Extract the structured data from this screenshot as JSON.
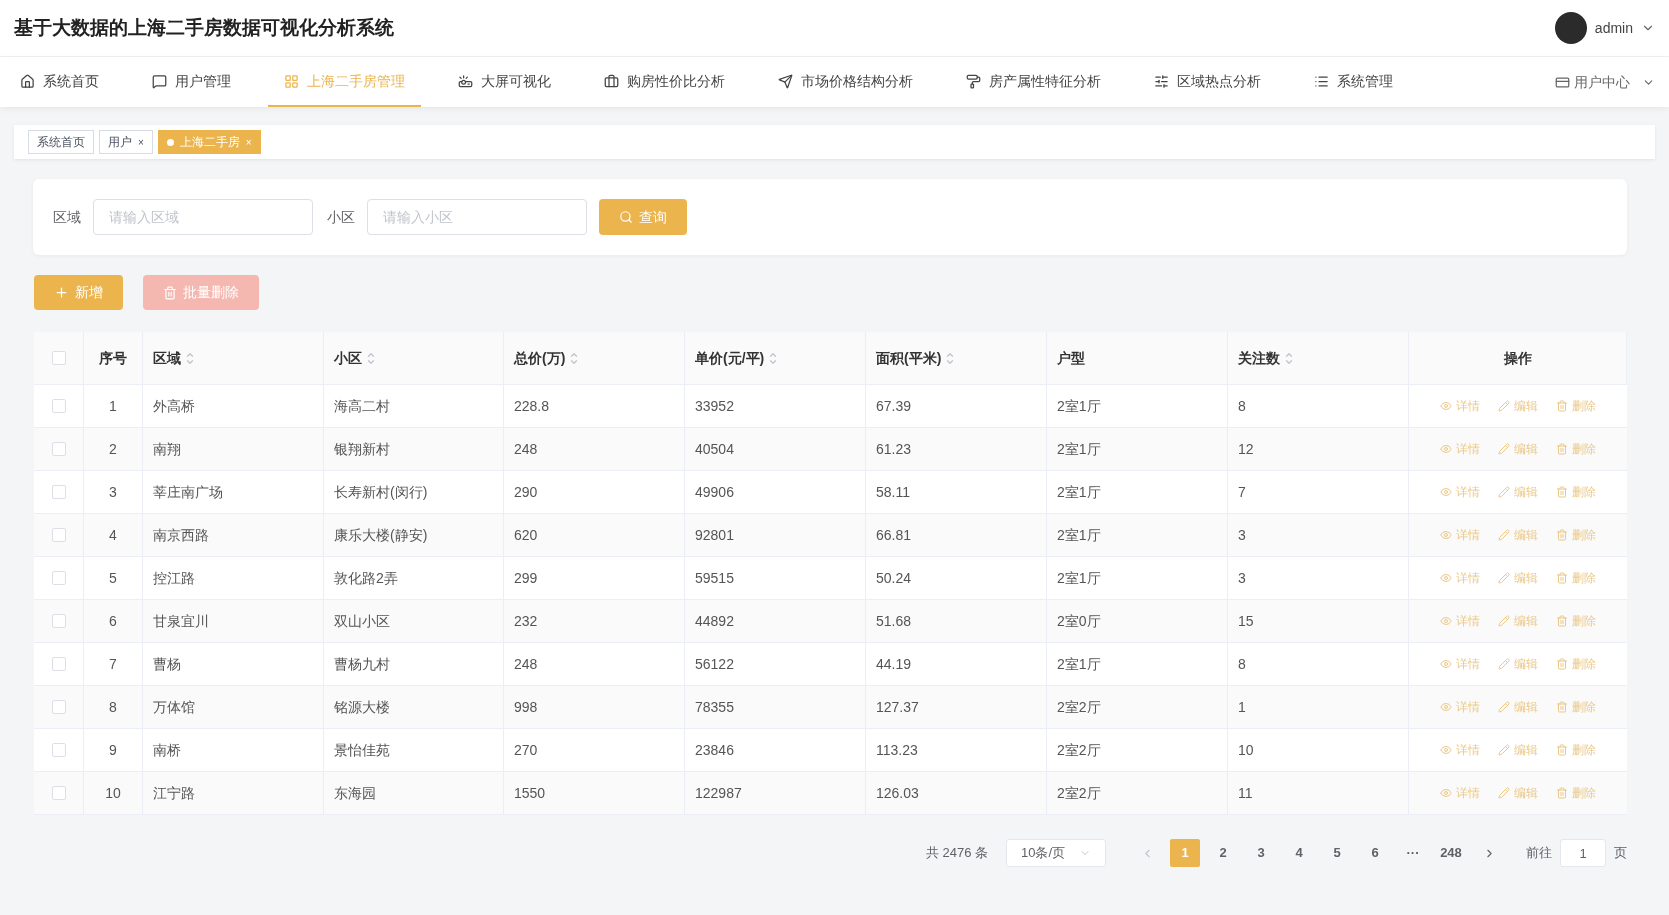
{
  "header": {
    "title": "基于大数据的上海二手房数据可视化分析系统",
    "user": "admin"
  },
  "nav": {
    "items": [
      {
        "label": "系统首页",
        "selected": false
      },
      {
        "label": "用户管理",
        "selected": false
      },
      {
        "label": "上海二手房管理",
        "selected": true
      },
      {
        "label": "大屏可视化",
        "selected": false
      },
      {
        "label": "购房性价比分析",
        "selected": false
      },
      {
        "label": "市场价格结构分析",
        "selected": false
      },
      {
        "label": "房产属性特征分析",
        "selected": false
      },
      {
        "label": "区域热点分析",
        "selected": false
      },
      {
        "label": "系统管理",
        "selected": false
      }
    ],
    "user_center": "用户中心"
  },
  "tags": [
    {
      "label": "系统首页",
      "selected": false
    },
    {
      "label": "用户",
      "selected": false,
      "close": "×"
    },
    {
      "label": "上海二手房",
      "selected": true,
      "close": "×"
    }
  ],
  "search": {
    "fields": [
      {
        "label": "区域",
        "placeholder": "请输入区域"
      },
      {
        "label": "小区",
        "placeholder": "请输入小区"
      }
    ],
    "button": "查询"
  },
  "actions": {
    "add": "新增",
    "batch_delete": "批量删除",
    "batch_delete_disabled": true
  },
  "table": {
    "columns": [
      {
        "label": "序号",
        "sortable": false
      },
      {
        "label": "区域",
        "sortable": true
      },
      {
        "label": "小区",
        "sortable": true
      },
      {
        "label": "总价(万)",
        "sortable": true
      },
      {
        "label": "单价(元/平)",
        "sortable": true
      },
      {
        "label": "面积(平米)",
        "sortable": true
      },
      {
        "label": "户型",
        "sortable": false
      },
      {
        "label": "关注数",
        "sortable": true
      },
      {
        "label": "操作",
        "sortable": false
      }
    ],
    "all_checked": false,
    "rows": [
      {
        "checked": false,
        "cells": [
          "1",
          "外高桥",
          "海高二村",
          "228.8",
          "33952",
          "67.39",
          "2室1厅",
          "8"
        ],
        "actions": [
          "详情",
          "编辑",
          "删除"
        ]
      },
      {
        "checked": false,
        "cells": [
          "2",
          "南翔",
          "银翔新村",
          "248",
          "40504",
          "61.23",
          "2室1厅",
          "12"
        ],
        "actions": [
          "详情",
          "编辑",
          "删除"
        ]
      },
      {
        "checked": false,
        "cells": [
          "3",
          "莘庄南广场",
          "长寿新村(闵行)",
          "290",
          "49906",
          "58.11",
          "2室1厅",
          "7"
        ],
        "actions": [
          "详情",
          "编辑",
          "删除"
        ]
      },
      {
        "checked": false,
        "cells": [
          "4",
          "南京西路",
          "康乐大楼(静安)",
          "620",
          "92801",
          "66.81",
          "2室1厅",
          "3"
        ],
        "actions": [
          "详情",
          "编辑",
          "删除"
        ]
      },
      {
        "checked": false,
        "cells": [
          "5",
          "控江路",
          "敦化路2弄",
          "299",
          "59515",
          "50.24",
          "2室1厅",
          "3"
        ],
        "actions": [
          "详情",
          "编辑",
          "删除"
        ]
      },
      {
        "checked": false,
        "cells": [
          "6",
          "甘泉宜川",
          "双山小区",
          "232",
          "44892",
          "51.68",
          "2室0厅",
          "15"
        ],
        "actions": [
          "详情",
          "编辑",
          "删除"
        ]
      },
      {
        "checked": false,
        "cells": [
          "7",
          "曹杨",
          "曹杨九村",
          "248",
          "56122",
          "44.19",
          "2室1厅",
          "8"
        ],
        "actions": [
          "详情",
          "编辑",
          "删除"
        ]
      },
      {
        "checked": false,
        "cells": [
          "8",
          "万体馆",
          "铭源大楼",
          "998",
          "78355",
          "127.37",
          "2室2厅",
          "1"
        ],
        "actions": [
          "详情",
          "编辑",
          "删除"
        ]
      },
      {
        "checked": false,
        "cells": [
          "9",
          "南桥",
          "景怡佳苑",
          "270",
          "23846",
          "113.23",
          "2室2厅",
          "10"
        ],
        "actions": [
          "详情",
          "编辑",
          "删除"
        ]
      },
      {
        "checked": false,
        "cells": [
          "10",
          "江宁路",
          "东海园",
          "1550",
          "122987",
          "126.03",
          "2室2厅",
          "11"
        ],
        "actions": [
          "详情",
          "编辑",
          "删除"
        ]
      }
    ]
  },
  "pagination": {
    "total": "共 2476 条",
    "page_size": "10条/页",
    "pages": [
      {
        "label": "1",
        "selected": true
      },
      {
        "label": "2",
        "selected": false
      },
      {
        "label": "3",
        "selected": false
      },
      {
        "label": "4",
        "selected": false
      },
      {
        "label": "5",
        "selected": false
      },
      {
        "label": "6",
        "selected": false
      },
      {
        "label": "···",
        "selected": false
      },
      {
        "label": "248",
        "selected": false
      }
    ],
    "goto_label": "前往",
    "goto_value": "1",
    "goto_unit": "页"
  }
}
